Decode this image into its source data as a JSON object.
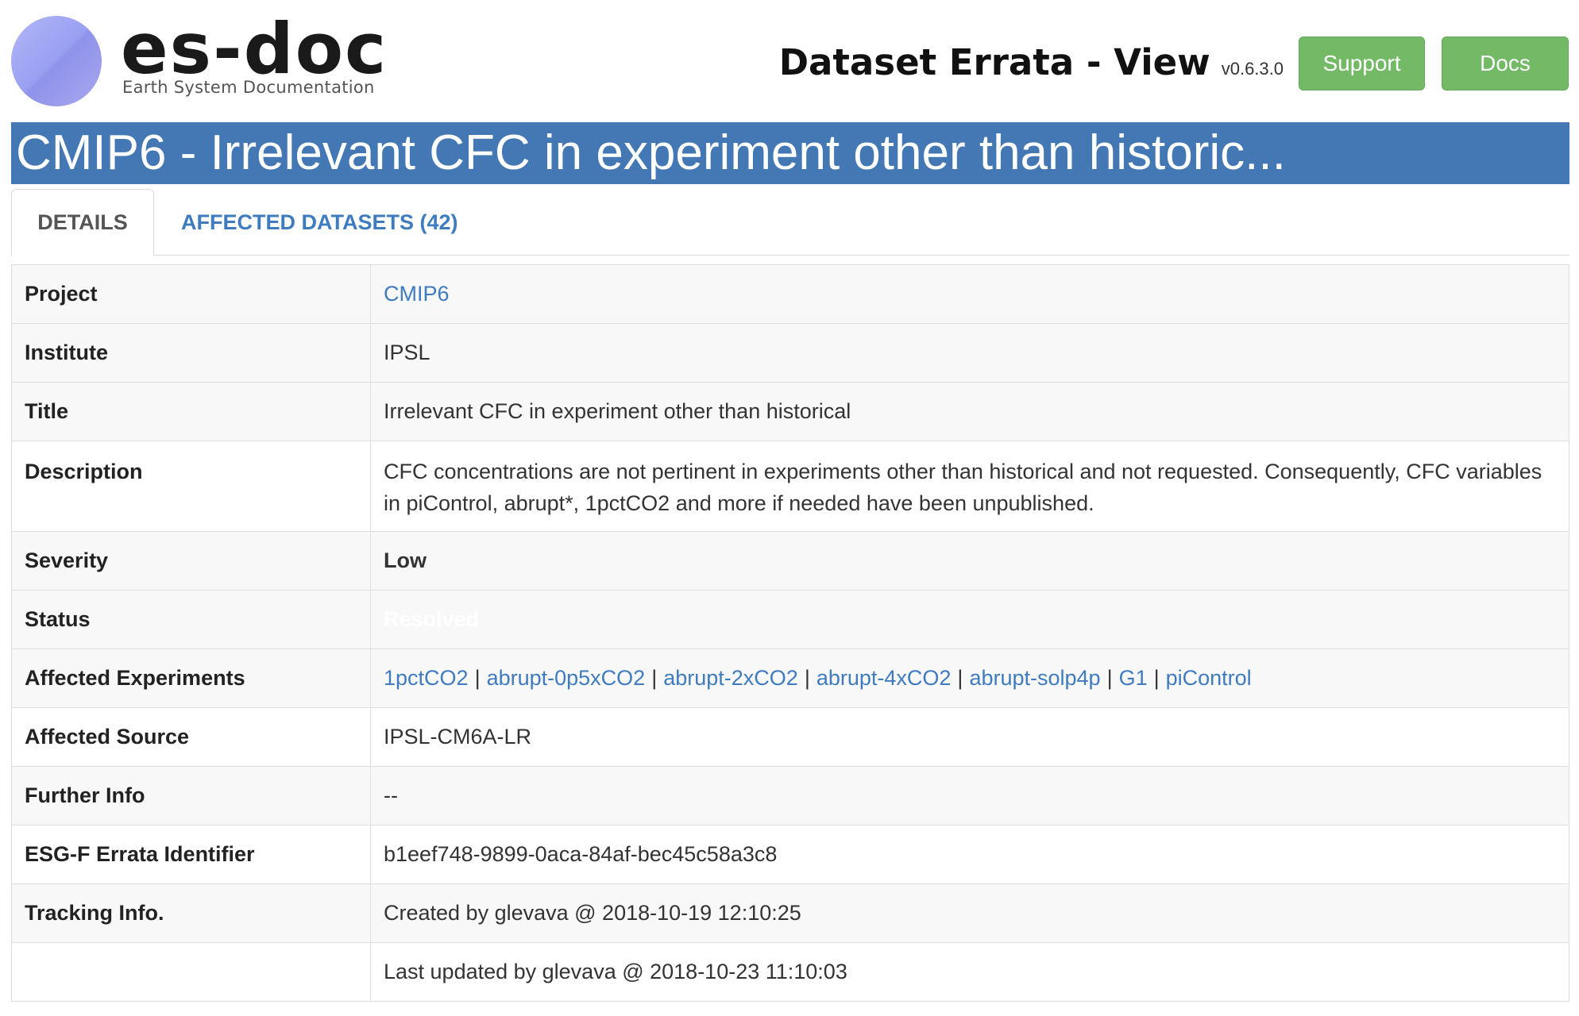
{
  "header": {
    "logo_text": "es-doc",
    "logo_subtitle": "Earth System Documentation",
    "page_title": "Dataset Errata - View",
    "version": "v0.6.3.0",
    "support_label": "Support",
    "docs_label": "Docs",
    "button_color": "#73b966"
  },
  "title_bar": {
    "text": "CMIP6 - Irrelevant CFC in experiment other than historic...",
    "color": "#4378b4"
  },
  "tabs": {
    "details": "DETAILS",
    "affected": "AFFECTED DATASETS (42)",
    "active": "details"
  },
  "details": {
    "project": {
      "label": "Project",
      "value": "CMIP6"
    },
    "institute": {
      "label": "Institute",
      "value": "IPSL"
    },
    "title": {
      "label": "Title",
      "value": "Irrelevant CFC in experiment other than historical"
    },
    "description": {
      "label": "Description",
      "value": "CFC concentrations are not pertinent in experiments other than historical and not requested. Consequently, CFC variables in piControl, abrupt*, 1pctCO2 and more if needed have been unpublished."
    },
    "severity": {
      "label": "Severity",
      "value": "Low",
      "color": "#e0b8b2"
    },
    "status": {
      "label": "Status",
      "value": "Resolved",
      "color": "#17343e"
    },
    "experiments": {
      "label": "Affected Experiments",
      "items": [
        "1pctCO2",
        "abrupt-0p5xCO2",
        "abrupt-2xCO2",
        "abrupt-4xCO2",
        "abrupt-solp4p",
        "G1",
        "piControl"
      ],
      "separator": "|"
    },
    "source": {
      "label": "Affected Source",
      "value": "IPSL-CM6A-LR"
    },
    "further_info": {
      "label": "Further Info",
      "value": "--"
    },
    "errata_id": {
      "label": "ESG-F Errata Identifier",
      "value": "b1eef748-9899-0aca-84af-bec45c58a3c8"
    },
    "tracking": {
      "label": "Tracking Info.",
      "created": "Created by glevava @ 2018-10-19 12:10:25",
      "updated": "Last updated by glevava @ 2018-10-23 11:10:03"
    }
  }
}
